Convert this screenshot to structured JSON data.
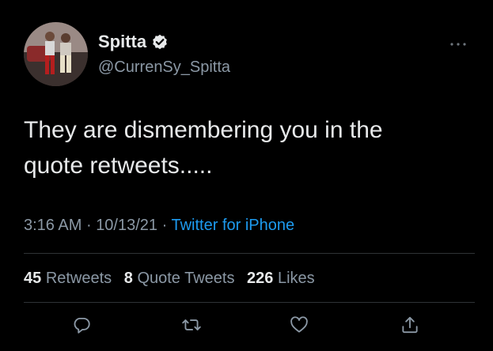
{
  "tweet": {
    "author": {
      "display_name": "Spitta",
      "handle": "@CurrenSy_Spitta",
      "verified": true
    },
    "more_icon": "more-horizontal-icon",
    "text_line_1": "They are dismembering you in the",
    "text_line_2": "quote retweets.....",
    "time": "3:16 AM",
    "date": "10/13/21",
    "separator": "·",
    "source": "Twitter for iPhone",
    "stats": {
      "retweets_count": "45",
      "retweets_label": "Retweets",
      "quote_tweets_count": "8",
      "quote_tweets_label": "Quote Tweets",
      "likes_count": "226",
      "likes_label": "Likes"
    },
    "actions": [
      "reply-icon",
      "retweet-icon",
      "like-icon",
      "share-icon"
    ],
    "colors": {
      "background": "#000000",
      "text": "#e7e9ea",
      "secondary": "#8b98a5",
      "accent": "#1d9bf0",
      "divider": "#2f3336"
    }
  }
}
